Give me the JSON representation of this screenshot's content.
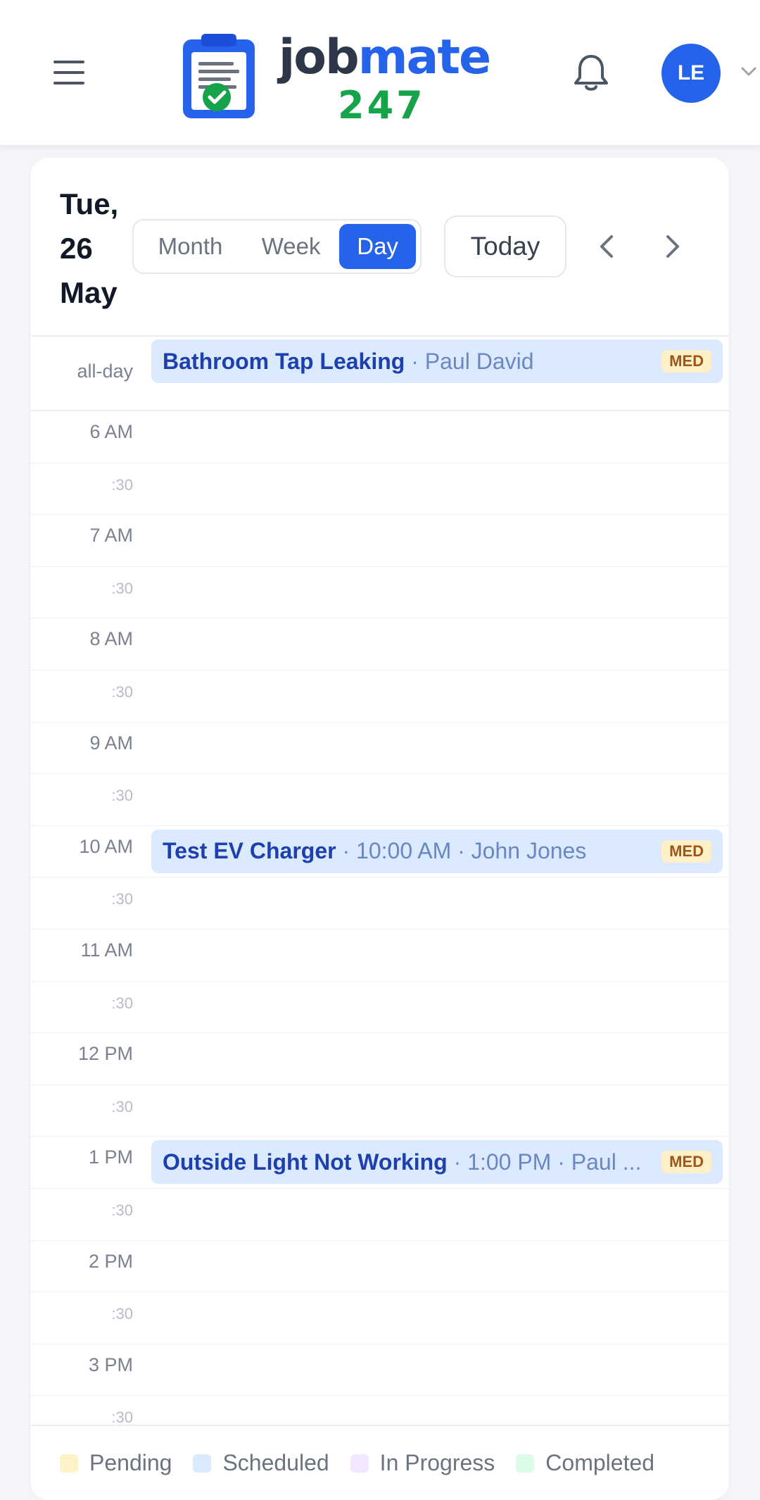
{
  "header": {
    "logo": {
      "word_part1": "job",
      "word_part2": "mate",
      "number": "247"
    },
    "user_initials": "LE",
    "colors": {
      "brand_blue": "#2563eb",
      "brand_green": "#16a34a",
      "brand_dark": "#2d3748"
    }
  },
  "calendar": {
    "date_title": "Tue, 26 May",
    "views": {
      "month": "Month",
      "week": "Week",
      "day": "Day",
      "active": "Day"
    },
    "today_label": "Today",
    "allday_label": "all-day",
    "time_slots": [
      "6 AM",
      ":30",
      "7 AM",
      ":30",
      "8 AM",
      ":30",
      "9 AM",
      ":30",
      "10 AM",
      ":30",
      "11 AM",
      ":30",
      "12 PM",
      ":30",
      "1 PM",
      ":30",
      "2 PM",
      ":30",
      "3 PM",
      ":30"
    ],
    "allday_event": {
      "title": "Bathroom Tap Leaking",
      "meta": " · Paul David",
      "badge": "MED"
    },
    "events": [
      {
        "title": "Test EV Charger",
        "meta": " · 10:00 AM · John Jones",
        "badge": "MED",
        "slot": "10 AM"
      },
      {
        "title": "Outside Light Not Working",
        "meta": " · 1:00 PM · Paul ...",
        "badge": "MED",
        "slot": "1 PM"
      }
    ],
    "event_color": "#dbeafe",
    "badge_color": "#fdf0c6"
  },
  "legend": [
    {
      "label": "Pending",
      "color": "#fef3c7"
    },
    {
      "label": "Scheduled",
      "color": "#dbeafe"
    },
    {
      "label": "In Progress",
      "color": "#f3e8ff"
    },
    {
      "label": "Completed",
      "color": "#dcfce7"
    }
  ],
  "icons": [
    "hamburger-icon",
    "logo-clipboard-icon",
    "bell-icon",
    "chevron-down-icon",
    "chevron-left-icon",
    "chevron-right-icon"
  ]
}
